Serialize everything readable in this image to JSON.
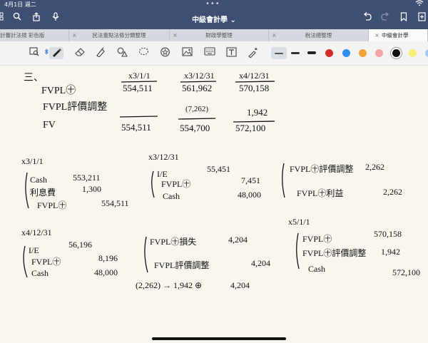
{
  "status": {
    "date": "4月1日 週二",
    "top_dots": "•••"
  },
  "app": {
    "title": "中級會計學 ⌄"
  },
  "icons": {
    "sidebar": "sidebar-grid-icon",
    "search": "search-icon",
    "share": "share-icon",
    "mic": "microphone-icon",
    "undo": "undo-icon",
    "redo": "redo-icon",
    "bookmark": "bookmark-icon",
    "add_page": "add-page-icon",
    "wifi": "wifi-icon"
  },
  "tabs": [
    {
      "label": "計審計法規 彩色版"
    },
    {
      "label": "民法重點法條分類整理"
    },
    {
      "label": "財政學整理"
    },
    {
      "label": "稅法總整理"
    },
    {
      "label": "中級會計學"
    }
  ],
  "tab_close": "×",
  "toolbar": {
    "tools": [
      "lasso-zoom-icon",
      "bluetooth-pen-icon",
      "pen-icon",
      "eraser-icon",
      "highlighter-icon",
      "shapes-icon",
      "lasso-icon",
      "sticker-icon",
      "image-icon",
      "keyboard-icon",
      "text-box-icon",
      "laser-pointer-icon"
    ],
    "colors": {
      "red": "#d62b2b",
      "blue": "#2f8fe8",
      "orange": "#f2a33a",
      "pink": "#f4a3a3",
      "black": "#111111",
      "yellow": "#f7ee7a",
      "sky": "#9ecbf5"
    }
  },
  "note": {
    "section": "三、",
    "row_fvpl": "FVPL㊉",
    "row_adj": "FVPL評價調整",
    "row_fv": "FV",
    "col1": {
      "head": "x3/1/1",
      "v1": "554,511",
      "v3": "554,511"
    },
    "col2": {
      "head": "x3/12/31",
      "v1": "561,962",
      "v2": "(7,262)",
      "v3": "554,700"
    },
    "col3": {
      "head": "x4/12/31",
      "v1": "570,158",
      "v2": "1,942",
      "v3": "572,100"
    },
    "j1": {
      "date": "x3/1/1",
      "d1": "Cash",
      "a1": "553,211",
      "d2": "利息費",
      "a2": "1,300",
      "c1": "FVPL㊉",
      "ca1": "554,511"
    },
    "j2": {
      "date": "x3/12/31",
      "amt": "55,451",
      "d1": "I/E",
      "d2": "FVPL㊉",
      "a2": "7,451",
      "c1": "Cash",
      "ca1": "48,000"
    },
    "j3": {
      "d1": "FVPL㊉評價調整",
      "a1": "2,262",
      "c1": "FVPL㊉利益",
      "ca1": "2,262"
    },
    "j4": {
      "date": "x4/12/31",
      "amt": "56,196",
      "d1": "I/E",
      "d2": "FVPL㊉",
      "a2": "8,196",
      "c1": "Cash",
      "ca1": "48,000"
    },
    "j5": {
      "d1": "FVPL㊉損失",
      "a1": "4,204",
      "c1": "FVPL評價調整",
      "ca1": "4,204",
      "calc": "(2,262) → 1,942 ⊕",
      "calc_amt": "4,204"
    },
    "j6": {
      "date": "x5/1/1",
      "d1": "FVPL㊉",
      "a1": "570,158",
      "d2": "FVPL㊉評價調整",
      "a2": "1,942",
      "c1": "Cash",
      "ca1": "572,100"
    }
  }
}
